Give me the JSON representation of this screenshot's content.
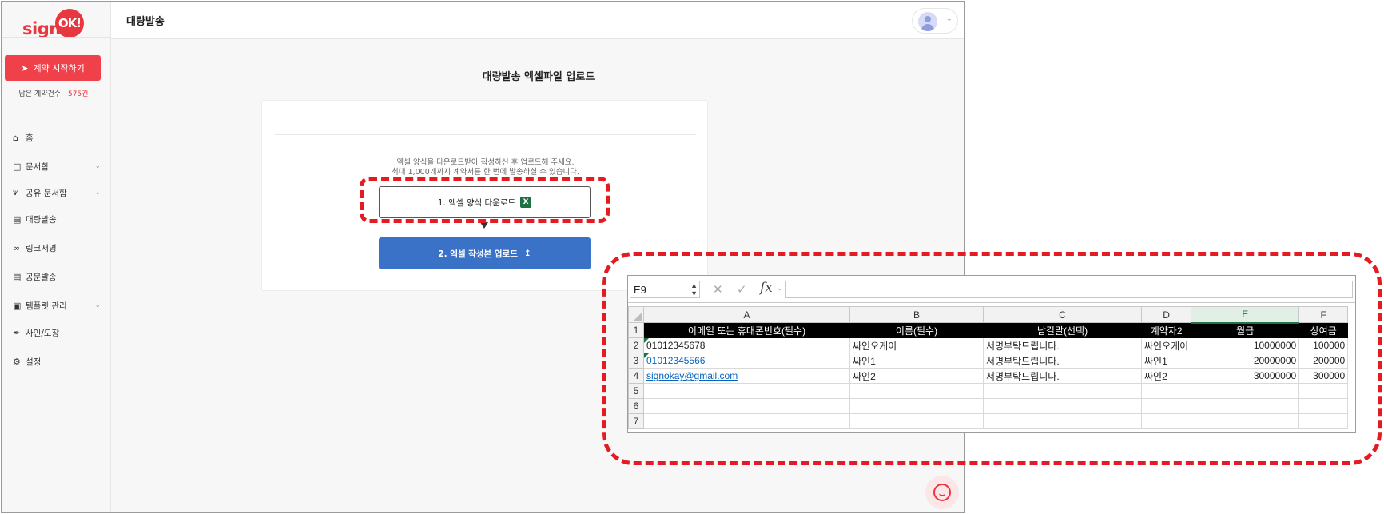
{
  "sidebar": {
    "logo_word": "sign",
    "logo_badge": "OK!",
    "start_button": "계약 시작하기",
    "remaining_label": "남은 계약건수",
    "remaining_count": "575건",
    "items": [
      {
        "label": "홈",
        "icon": "home-icon"
      },
      {
        "label": "문서함",
        "icon": "folder-icon"
      },
      {
        "label": "공유 문서함",
        "icon": "share-icon"
      },
      {
        "label": "대량발송",
        "icon": "bulk-send-icon"
      },
      {
        "label": "링크서명",
        "icon": "link-icon"
      },
      {
        "label": "공문발송",
        "icon": "document-icon"
      },
      {
        "label": "템플릿 관리",
        "icon": "template-icon"
      },
      {
        "label": "사인/도장",
        "icon": "pen-icon"
      },
      {
        "label": "설정",
        "icon": "gear-icon"
      }
    ]
  },
  "header": {
    "title": "대량발송"
  },
  "main": {
    "title": "대량발송 엑셀파일 업로드",
    "desc_line1": "엑셀 양식을 다운로드받아 작성하신 후 업로드해 주세요.",
    "desc_line2": "최대 1,000개까지 계약서를 한 번에 발송하실 수 있습니다.",
    "download_button": "1. 엑셀 양식 다운로드",
    "upload_button": "2. 엑셀 작성본 업로드"
  },
  "excel": {
    "name_box": "E9",
    "fx_label": "fx",
    "columns": [
      "A",
      "B",
      "C",
      "D",
      "E",
      "F"
    ],
    "selected_column": "E",
    "row_numbers": [
      "1",
      "2",
      "3",
      "4",
      "5",
      "6",
      "7"
    ],
    "header_row": [
      "이메일 또는 휴대폰번호(필수)",
      "이름(필수)",
      "남길말(선택)",
      "계약자2",
      "월급",
      "상여금"
    ],
    "rows": [
      [
        "01012345678",
        "싸인오케이",
        "서명부탁드립니다.",
        "싸인오케이",
        "10000000",
        "100000"
      ],
      [
        "01012345566",
        "싸인1",
        "서명부탁드립니다.",
        "싸인1",
        "20000000",
        "200000"
      ],
      [
        "signokay@gmail.com",
        "싸인2",
        "서명부탁드립니다.",
        "싸인2",
        "30000000",
        "300000"
      ]
    ]
  },
  "colors": {
    "brand_red": "#e8373f",
    "upload_blue": "#3a72c8",
    "highlight_red": "#e41b23",
    "excel_green": "#1e7145"
  }
}
